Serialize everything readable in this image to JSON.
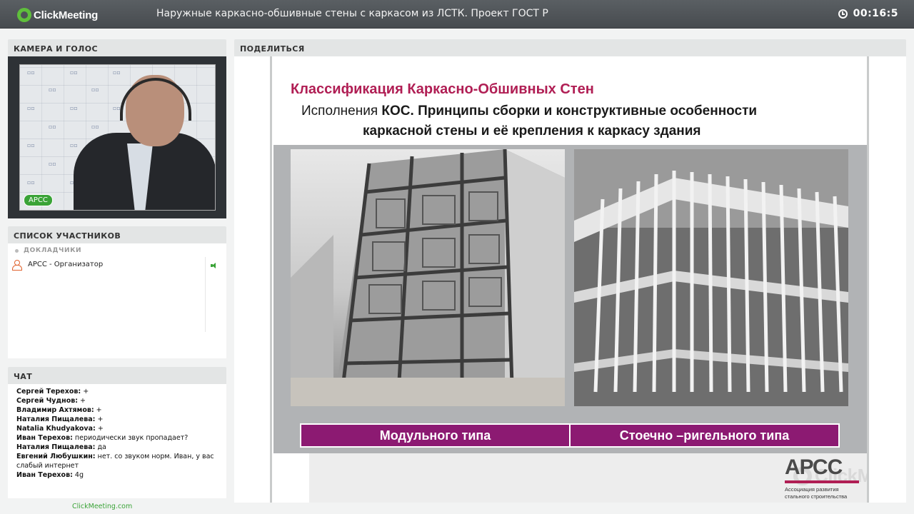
{
  "app": {
    "brand": "ClickMeeting",
    "title": "Наружные каркасно-обшивные стены с каркасом из ЛСТК. Проект ГОСТ Р",
    "timer": "00:16:5"
  },
  "camera": {
    "header": "КАМЕРА И ГОЛОС",
    "badge": "АРСС"
  },
  "participants": {
    "header": "СПИСОК УЧАСТНИКОВ",
    "group_label": "ДОКЛАДЧИКИ",
    "items": [
      {
        "name": "АРСС  - Организатор"
      }
    ]
  },
  "chat": {
    "header": "ЧАТ",
    "messages": [
      {
        "author": "Сергей Терехов:",
        "text": " +"
      },
      {
        "author": "Сергей Чуднов:",
        "text": " +"
      },
      {
        "author": "Владимир  Ахтямов:",
        "text": " +"
      },
      {
        "author": "Наталия Пищалева:",
        "text": " +"
      },
      {
        "author": "Natalia Khudyakova:",
        "text": " +"
      },
      {
        "author": "Иван Терехов:",
        "text": " периодически звук пропадает?"
      },
      {
        "author": "Наталия Пищалева:",
        "text": " да"
      },
      {
        "author": "Евгений Любушкин:",
        "text": " нет. со звуком норм. Иван, у вас слабый интернет"
      },
      {
        "author": "Иван Терехов:",
        "text": " 4g"
      }
    ]
  },
  "footer": {
    "link": "ClickMeeting.com"
  },
  "share": {
    "header": "ПОДЕЛИТЬСЯ",
    "slide": {
      "title": "Классификация Каркасно-Обшивных  Стен",
      "subtitle_prefix": "Исполнения ",
      "subtitle_bold": "КОС.  Принципы сборки и конструктивные особенности",
      "subtitle_line2": "каркасной  стены и её крепления  к  каркасу здания",
      "label_left": "Модульного типа",
      "label_right": "Стоечно –ригельного типа",
      "logo_name": "АРСС",
      "logo_caption_1": "Ассоциация развития",
      "logo_caption_2": "стального строительства",
      "watermark": "ClickMeeting"
    }
  },
  "colors": {
    "accent_green": "#3aa337",
    "slide_title": "#b01e54",
    "label_bar": "#8c1a72"
  }
}
